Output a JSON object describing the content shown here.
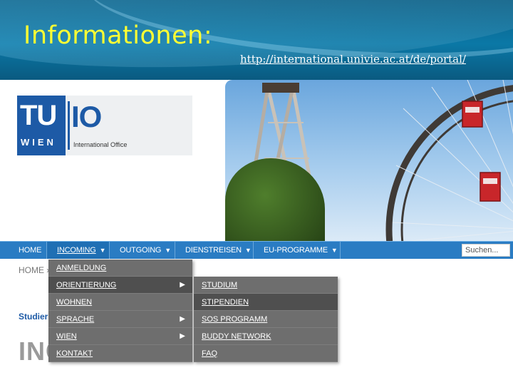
{
  "slide": {
    "title": "Informationen:",
    "link": "http://international.univie.ac.at/de/portal/"
  },
  "logo": {
    "tu": "TU",
    "wien": "WIEN",
    "io": "IO",
    "subtitle": "International Office"
  },
  "nav": {
    "items": [
      {
        "label": "HOME",
        "dropdown": false
      },
      {
        "label": "INCOMING",
        "dropdown": true
      },
      {
        "label": "OUTGOING",
        "dropdown": true
      },
      {
        "label": "DIENSTREISEN",
        "dropdown": true
      },
      {
        "label": "EU-PROGRAMME",
        "dropdown": true
      }
    ],
    "search_value": "Suchen...",
    "dropdown_icon": "triangle-down-icon"
  },
  "breadcrumb": "HOME »",
  "side_label": "Studier",
  "page_heading": "INC",
  "menu_incoming": [
    {
      "label": "ANMELDUNG",
      "has_sub": false
    },
    {
      "label": "ORIENTIERUNG",
      "has_sub": true
    },
    {
      "label": "WOHNEN",
      "has_sub": false
    },
    {
      "label": "SPRACHE",
      "has_sub": true
    },
    {
      "label": "WIEN",
      "has_sub": true
    },
    {
      "label": "KONTAKT",
      "has_sub": false
    }
  ],
  "menu_orientierung": [
    {
      "label": "STUDIUM"
    },
    {
      "label": "STIPENDIEN"
    },
    {
      "label": "SOS PROGRAMM"
    },
    {
      "label": "BUDDY NETWORK"
    },
    {
      "label": "FAQ"
    }
  ],
  "colors": {
    "slide_title": "#ffff33",
    "nav": "#2a7cc3",
    "menu": "#6e6e6e",
    "menu_highlight": "#4f4f4f",
    "logo_blue": "#1d5aa6"
  }
}
